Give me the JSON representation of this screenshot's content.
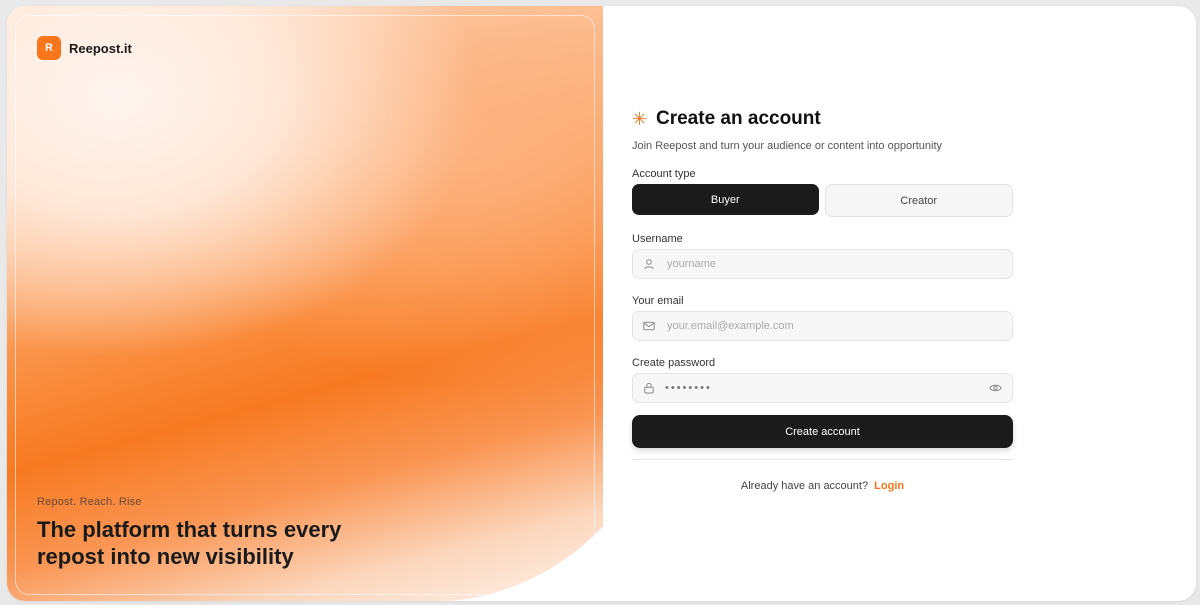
{
  "brand": {
    "logo_letter": "R",
    "name": "Reepost.it"
  },
  "hero": {
    "tagline": "Repost. Reach. Rise",
    "headline": "The platform that turns every repost into new visibility"
  },
  "form": {
    "title": "Create an account",
    "subtitle": "Join Reepost and turn your audience or content into opportunity",
    "account_type_label": "Account type",
    "account_types": [
      "Buyer",
      "Creator"
    ],
    "selected_account_type": "Buyer",
    "username_label": "Username",
    "username_placeholder": "yourname",
    "email_label": "Your email",
    "email_placeholder": "your.email@example.com",
    "password_label": "Create password",
    "password_value": "••••••••",
    "submit_label": "Create account",
    "login_prompt": "Already have an account?",
    "login_link": "Login"
  },
  "colors": {
    "accent": "#f7761c",
    "dark": "#1b1b1b"
  },
  "icons": {
    "title": "asterisk-icon",
    "username": "user-icon",
    "email": "mail-icon",
    "password": "lock-icon",
    "reveal": "eye-icon"
  }
}
